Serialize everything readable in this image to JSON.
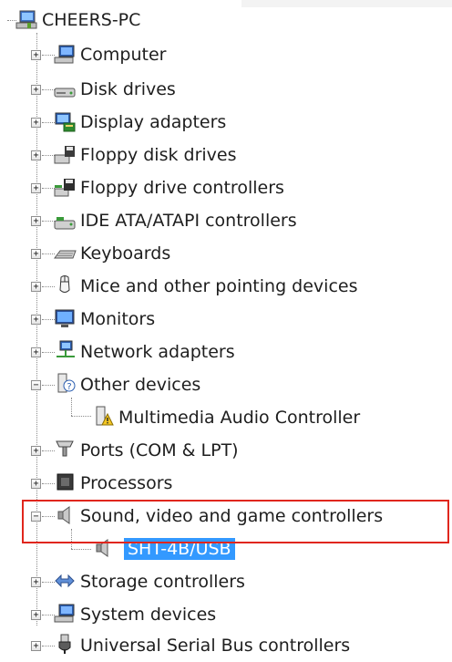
{
  "tree": {
    "root": {
      "label": "CHEERS-PC",
      "icon": "computer-icon"
    },
    "nodes": [
      {
        "label": "Computer",
        "icon": "computer-icon",
        "expand": "+"
      },
      {
        "label": "Disk drives",
        "icon": "disk-drive-icon",
        "expand": "+"
      },
      {
        "label": "Display adapters",
        "icon": "display-adapter-icon",
        "expand": "+"
      },
      {
        "label": "Floppy disk drives",
        "icon": "floppy-disk-icon",
        "expand": "+"
      },
      {
        "label": "Floppy drive controllers",
        "icon": "floppy-controller-icon",
        "expand": "+"
      },
      {
        "label": "IDE ATA/ATAPI controllers",
        "icon": "ide-controller-icon",
        "expand": "+"
      },
      {
        "label": "Keyboards",
        "icon": "keyboard-icon",
        "expand": "+"
      },
      {
        "label": "Mice and other pointing devices",
        "icon": "mouse-icon",
        "expand": "+"
      },
      {
        "label": "Monitors",
        "icon": "monitor-icon",
        "expand": "+"
      },
      {
        "label": "Network adapters",
        "icon": "network-adapter-icon",
        "expand": "+"
      },
      {
        "label": "Other devices",
        "icon": "unknown-device-icon",
        "expand": "−",
        "children": [
          {
            "label": "Multimedia Audio Controller",
            "icon": "warning-device-icon"
          }
        ]
      },
      {
        "label": "Ports (COM & LPT)",
        "icon": "port-icon",
        "expand": "+"
      },
      {
        "label": "Processors",
        "icon": "processor-icon",
        "expand": "+"
      },
      {
        "label": "Sound, video and game controllers",
        "icon": "speaker-icon",
        "expand": "−",
        "children": [
          {
            "label": "SHT-4B/USB",
            "icon": "speaker-icon",
            "selected": true
          }
        ]
      },
      {
        "label": "Storage controllers",
        "icon": "storage-controller-icon",
        "expand": "+"
      },
      {
        "label": "System devices",
        "icon": "system-device-icon",
        "expand": "+"
      },
      {
        "label": "Universal Serial Bus controllers",
        "icon": "usb-icon",
        "expand": "+"
      }
    ]
  },
  "colors": {
    "selection": "#3399ff",
    "highlight_border": "#e0261d"
  }
}
